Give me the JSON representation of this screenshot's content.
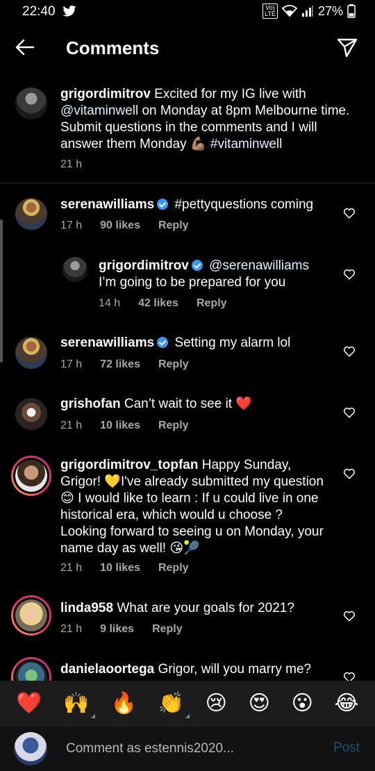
{
  "status": {
    "time": "22:40",
    "volte_top": "Vo)",
    "volte_bottom": "LTE",
    "battery": "27%"
  },
  "header": {
    "title": "Comments"
  },
  "caption": {
    "username": "grigordimitrov",
    "text_1": "Excited for my IG live with ",
    "mention": "@vitaminwell",
    "text_2": " on Monday at 8pm Melbourne time. Submit questions in the comments and I will answer them Monday ",
    "emoji": "💪🏽",
    "hashtag": " #vitaminwell",
    "time": "21 h"
  },
  "comments": [
    {
      "username": "serenawilliams",
      "text": "#pettyquestions coming",
      "time": "17 h",
      "likes": "90 likes",
      "reply": "Reply"
    },
    {
      "username": "grigordimitrov",
      "mention": "@serenawilliams",
      "text": "I’m going to be prepared for you",
      "time": "14 h",
      "likes": "42 likes",
      "reply": "Reply"
    },
    {
      "username": "serenawilliams",
      "text": "Setting my alarm lol",
      "time": "17 h",
      "likes": "72 likes",
      "reply": "Reply"
    },
    {
      "username": "grishofan",
      "text": "Can’t wait to see it ❤️",
      "time": "21 h",
      "likes": "10 likes",
      "reply": "Reply"
    },
    {
      "username": "grigordimitrov_topfan",
      "text": "Happy Sunday, Grigor! 💛I've already submitted my question😊 I would like to learn : If u could live in one historical era, which would u choose ? Looking forward to seeing u on Monday, your name day as well! 😘🎾",
      "time": "21 h",
      "likes": "10 likes",
      "reply": "Reply"
    },
    {
      "username": "linda958",
      "text": "What are your goals for 2021?",
      "time": "21 h",
      "likes": "9 likes",
      "reply": "Reply"
    },
    {
      "username": "danielaoortega",
      "text": "Grigor, will you marry me?"
    }
  ],
  "emojis": [
    "❤️",
    "🙌",
    "🔥",
    "👏",
    "😢",
    "😍",
    "😮",
    "😂"
  ],
  "input": {
    "placeholder": "Comment as estennis2020...",
    "post_label": "Post"
  }
}
